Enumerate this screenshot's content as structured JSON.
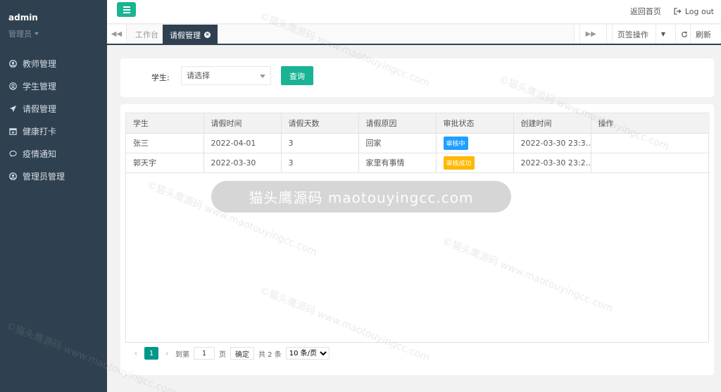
{
  "user": {
    "name": "admin",
    "role": "管理员"
  },
  "sidebar": {
    "items": [
      {
        "label": "教师管理",
        "icon": "user-circle-icon"
      },
      {
        "label": "学生管理",
        "icon": "user-circle-outline-icon"
      },
      {
        "label": "请假管理",
        "icon": "send-icon"
      },
      {
        "label": "健康打卡",
        "icon": "calendar-icon"
      },
      {
        "label": "疫情通知",
        "icon": "chat-icon"
      },
      {
        "label": "管理员管理",
        "icon": "user-circle-icon"
      }
    ]
  },
  "topbar": {
    "home_label": "返回首页",
    "logout_label": "Log out"
  },
  "tabs": {
    "items": [
      {
        "label": "工作台"
      },
      {
        "label": "请假管理"
      }
    ],
    "page_ops_label": "页签操作",
    "refresh_label": "刷新"
  },
  "search": {
    "label": "学生:",
    "placeholder": "请选择",
    "button_label": "查询"
  },
  "table": {
    "headers": [
      "学生",
      "请假时间",
      "请假天数",
      "请假原因",
      "审批状态",
      "创建时间",
      "操作"
    ],
    "rows": [
      {
        "student": "张三",
        "date": "2022-04-01",
        "days": "3",
        "reason": "回家",
        "status": "审核中",
        "status_color": "#1e9fff",
        "created": "2022-03-30 23:3…"
      },
      {
        "student": "郭天宇",
        "date": "2022-03-30",
        "days": "3",
        "reason": "家里有事情",
        "status": "审核成功",
        "status_color": "#ffb800",
        "created": "2022-03-30 23:2…"
      }
    ]
  },
  "pager": {
    "current": "1",
    "goto_label": "到第",
    "goto_value": "1",
    "page_unit": "页",
    "confirm_label": "确定",
    "total_label": "共 2 条",
    "page_size": "10 条/页"
  },
  "watermark": {
    "band_text": "猫头鹰源码 maotouyingcc.com",
    "tile_text": "©猫头鹰源码 www.maotouyingcc.com"
  },
  "colors": {
    "sidebar": "#2f4050",
    "accent": "#1ab394",
    "pager_active": "#009688"
  }
}
